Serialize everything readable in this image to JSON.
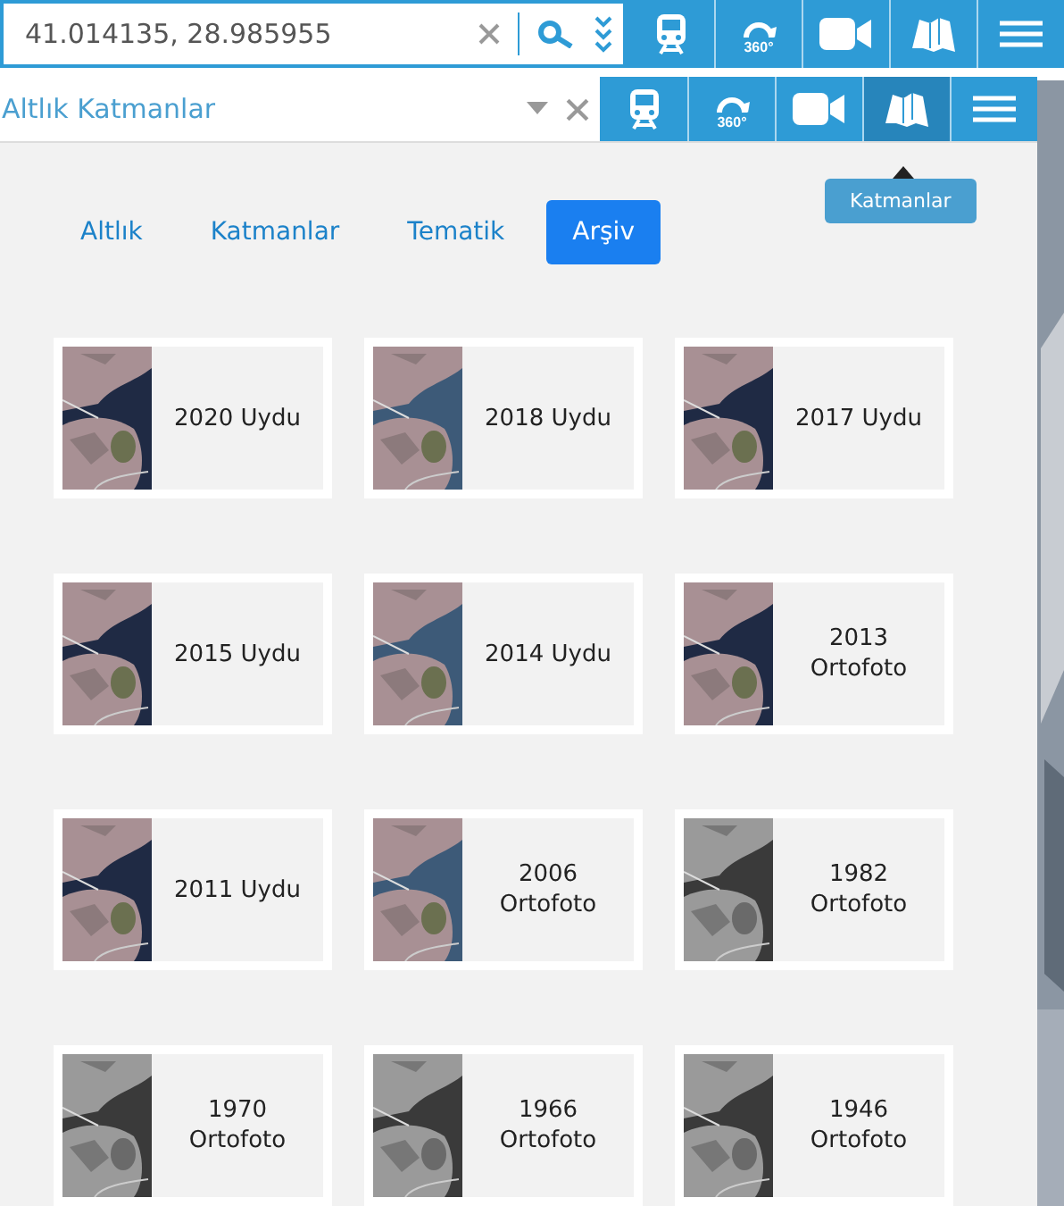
{
  "search": {
    "value": "41.014135, 28.985955"
  },
  "layer_select": {
    "value": "Altlık Katmanlar"
  },
  "toolbar_top": [
    {
      "kind": "train",
      "selected": false
    },
    {
      "kind": "pano",
      "label": "360°",
      "selected": false
    },
    {
      "kind": "video",
      "selected": false
    },
    {
      "kind": "map",
      "selected": false
    },
    {
      "kind": "menu",
      "selected": false
    }
  ],
  "toolbar_layers": [
    {
      "kind": "train",
      "selected": false
    },
    {
      "kind": "pano",
      "label": "360°",
      "selected": false
    },
    {
      "kind": "video",
      "selected": false
    },
    {
      "kind": "map",
      "selected": true
    },
    {
      "kind": "menu",
      "selected": false
    }
  ],
  "tooltip": "Katmanlar",
  "tabs": [
    {
      "label": "Altlık",
      "selected": false
    },
    {
      "label": "Katmanlar",
      "selected": false
    },
    {
      "label": "Tematik",
      "selected": false
    },
    {
      "label": "Arşiv",
      "selected": true
    }
  ],
  "layers": [
    {
      "label": "2020 Uydu"
    },
    {
      "label": "2018 Uydu"
    },
    {
      "label": "2017 Uydu"
    },
    {
      "label": "2015 Uydu"
    },
    {
      "label": "2014 Uydu"
    },
    {
      "label": "2013 Ortofoto"
    },
    {
      "label": "2011 Uydu"
    },
    {
      "label": "2006 Ortofoto"
    },
    {
      "label": "1982 Ortofoto"
    },
    {
      "label": "1970 Ortofoto"
    },
    {
      "label": "1966 Ortofoto"
    },
    {
      "label": "1946 Ortofoto"
    }
  ]
}
